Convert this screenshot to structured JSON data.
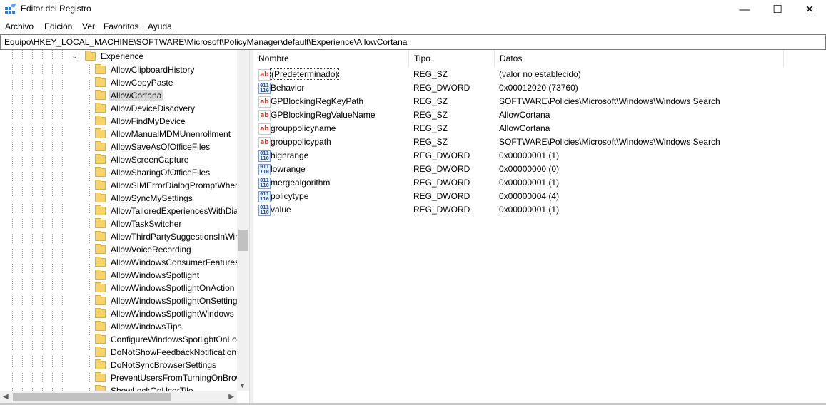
{
  "window": {
    "title": "Editor del Registro",
    "controls": {
      "minimize": "—",
      "maximize": "☐",
      "close": "✕"
    }
  },
  "menu": [
    "Archivo",
    "Edición",
    "Ver",
    "Favoritos",
    "Ayuda"
  ],
  "address": "Equipo\\HKEY_LOCAL_MACHINE\\SOFTWARE\\Microsoft\\PolicyManager\\default\\Experience\\AllowCortana",
  "tree": {
    "parent": {
      "label": "Experience",
      "expander": "⌄"
    },
    "selected_label": "AllowCortana",
    "items": [
      "AllowClipboardHistory",
      "AllowCopyPaste",
      "AllowCortana",
      "AllowDeviceDiscovery",
      "AllowFindMyDevice",
      "AllowManualMDMUnenrollment",
      "AllowSaveAsOfOfficeFiles",
      "AllowScreenCapture",
      "AllowSharingOfOfficeFiles",
      "AllowSIMErrorDialogPromptWhen",
      "AllowSyncMySettings",
      "AllowTailoredExperiencesWithDiag",
      "AllowTaskSwitcher",
      "AllowThirdPartySuggestionsInWin",
      "AllowVoiceRecording",
      "AllowWindowsConsumerFeatures",
      "AllowWindowsSpotlight",
      "AllowWindowsSpotlightOnAction",
      "AllowWindowsSpotlightOnSetting",
      "AllowWindowsSpotlightWindows",
      "AllowWindowsTips",
      "ConfigureWindowsSpotlightOnLo",
      "DoNotShowFeedbackNotification",
      "DoNotSyncBrowserSettings",
      "PreventUsersFromTurningOnBrow",
      "ShowLockOnUserTile"
    ]
  },
  "columns": {
    "name": "Nombre",
    "type": "Tipo",
    "data": "Datos"
  },
  "values": [
    {
      "icon": "string-value-icon",
      "name": "(Predeterminado)",
      "type": "REG_SZ",
      "data": "(valor no establecido)"
    },
    {
      "icon": "dword-value-icon",
      "name": "Behavior",
      "type": "REG_DWORD",
      "data": "0x00012020 (73760)"
    },
    {
      "icon": "string-value-icon",
      "name": "GPBlockingRegKeyPath",
      "type": "REG_SZ",
      "data": "SOFTWARE\\Policies\\Microsoft\\Windows\\Windows Search"
    },
    {
      "icon": "string-value-icon",
      "name": "GPBlockingRegValueName",
      "type": "REG_SZ",
      "data": "AllowCortana"
    },
    {
      "icon": "string-value-icon",
      "name": "grouppolicyname",
      "type": "REG_SZ",
      "data": "AllowCortana"
    },
    {
      "icon": "string-value-icon",
      "name": "grouppolicypath",
      "type": "REG_SZ",
      "data": "SOFTWARE\\Policies\\Microsoft\\Windows\\Windows Search"
    },
    {
      "icon": "dword-value-icon",
      "name": "highrange",
      "type": "REG_DWORD",
      "data": "0x00000001 (1)"
    },
    {
      "icon": "dword-value-icon",
      "name": "lowrange",
      "type": "REG_DWORD",
      "data": "0x00000000 (0)"
    },
    {
      "icon": "dword-value-icon",
      "name": "mergealgorithm",
      "type": "REG_DWORD",
      "data": "0x00000001 (1)"
    },
    {
      "icon": "dword-value-icon",
      "name": "policytype",
      "type": "REG_DWORD",
      "data": "0x00000004 (4)"
    },
    {
      "icon": "dword-value-icon",
      "name": "value",
      "type": "REG_DWORD",
      "data": "0x00000001 (1)"
    }
  ],
  "icon_glyphs": {
    "string": "ab",
    "dword": "011 110"
  },
  "colors": {
    "folder": "#f6d36b",
    "selection": "#d9d9d9",
    "string_icon": "#c0392b",
    "dword_icon": "#1c4fa1"
  }
}
